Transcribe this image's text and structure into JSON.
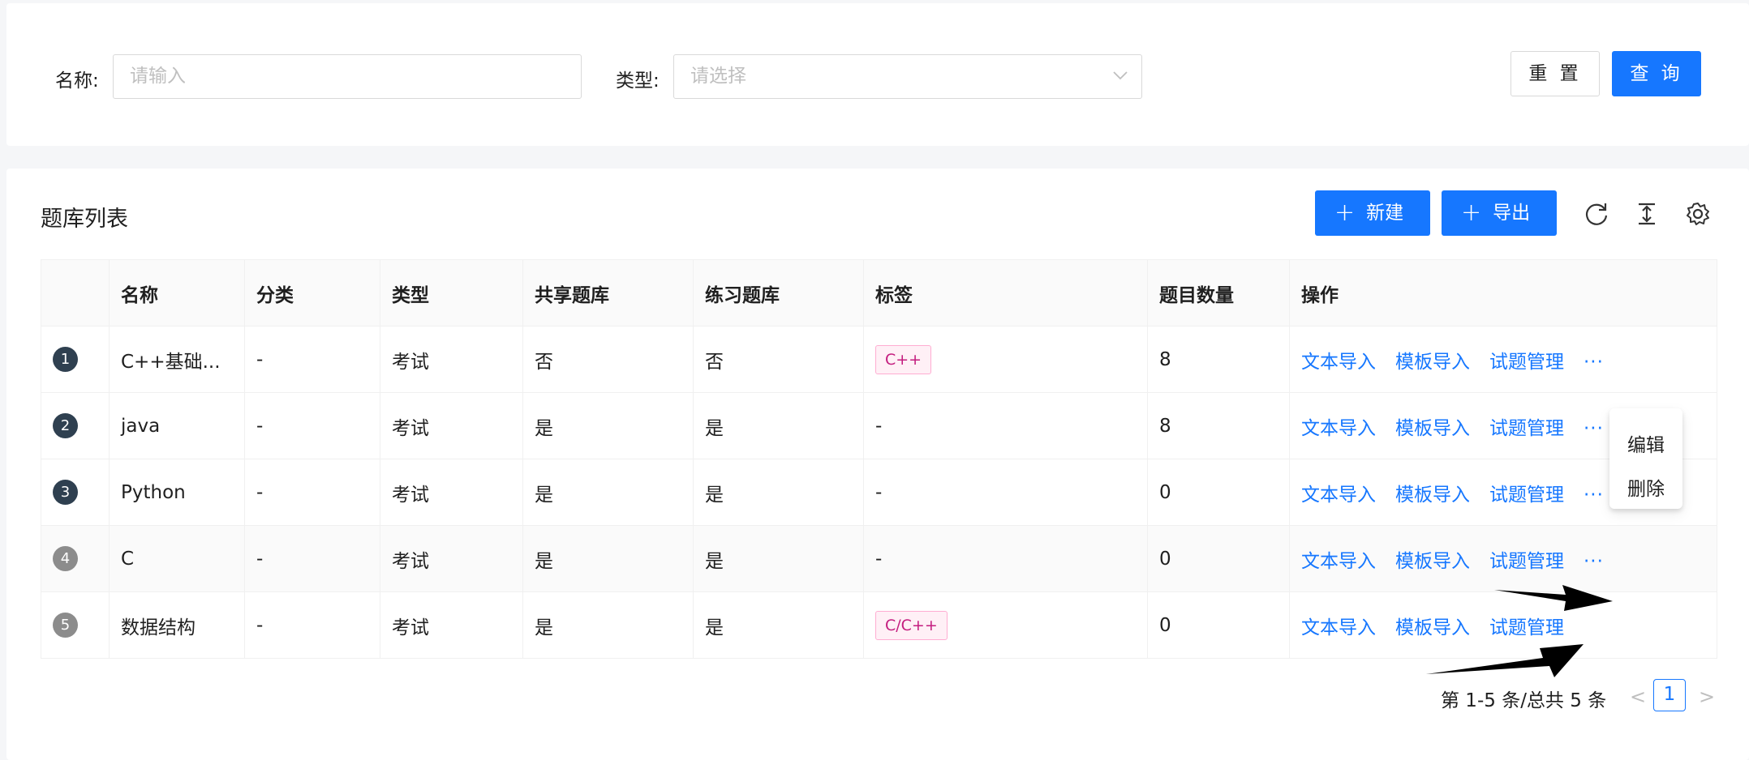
{
  "search": {
    "name_label": "名称:",
    "name_placeholder": "请输入",
    "type_label": "类型:",
    "type_placeholder": "请选择",
    "reset_label": "重 置",
    "query_label": "查 询"
  },
  "list": {
    "title": "题库列表",
    "new_label": "新建",
    "export_label": "导出",
    "columns": [
      "名称",
      "分类",
      "类型",
      "共享题库",
      "练习题库",
      "标签",
      "题目数量",
      "操作"
    ],
    "rows": [
      {
        "index": "1",
        "name": "C++基础...",
        "category": "-",
        "type": "考试",
        "shared": "否",
        "practice": "否",
        "tag": "C++",
        "count": "8"
      },
      {
        "index": "2",
        "name": "java",
        "category": "-",
        "type": "考试",
        "shared": "是",
        "practice": "是",
        "tag": "-",
        "count": "8"
      },
      {
        "index": "3",
        "name": "Python",
        "category": "-",
        "type": "考试",
        "shared": "是",
        "practice": "是",
        "tag": "-",
        "count": "0"
      },
      {
        "index": "4",
        "name": "C",
        "category": "-",
        "type": "考试",
        "shared": "是",
        "practice": "是",
        "tag": "-",
        "count": "0"
      },
      {
        "index": "5",
        "name": "数据结构",
        "category": "-",
        "type": "考试",
        "shared": "是",
        "practice": "是",
        "tag": "C/C++",
        "count": "0"
      }
    ],
    "actions": {
      "text_import": "文本导入",
      "template_import": "模板导入",
      "question_manage": "试题管理",
      "more": "···"
    }
  },
  "dropdown": {
    "edit": "编辑",
    "delete": "删除"
  },
  "pagination": {
    "total_text": "第 1-5 条/总共 5 条",
    "current_page": "1",
    "prev": "<",
    "next": ">"
  },
  "colors": {
    "primary": "#1677ff",
    "tag_text": "#c41d7f",
    "tag_bg": "#fff0f6",
    "tag_border": "#ffadd2"
  },
  "icons": [
    "chevron-down-icon",
    "plus-icon",
    "reload-icon",
    "column-height-icon",
    "setting-icon"
  ]
}
